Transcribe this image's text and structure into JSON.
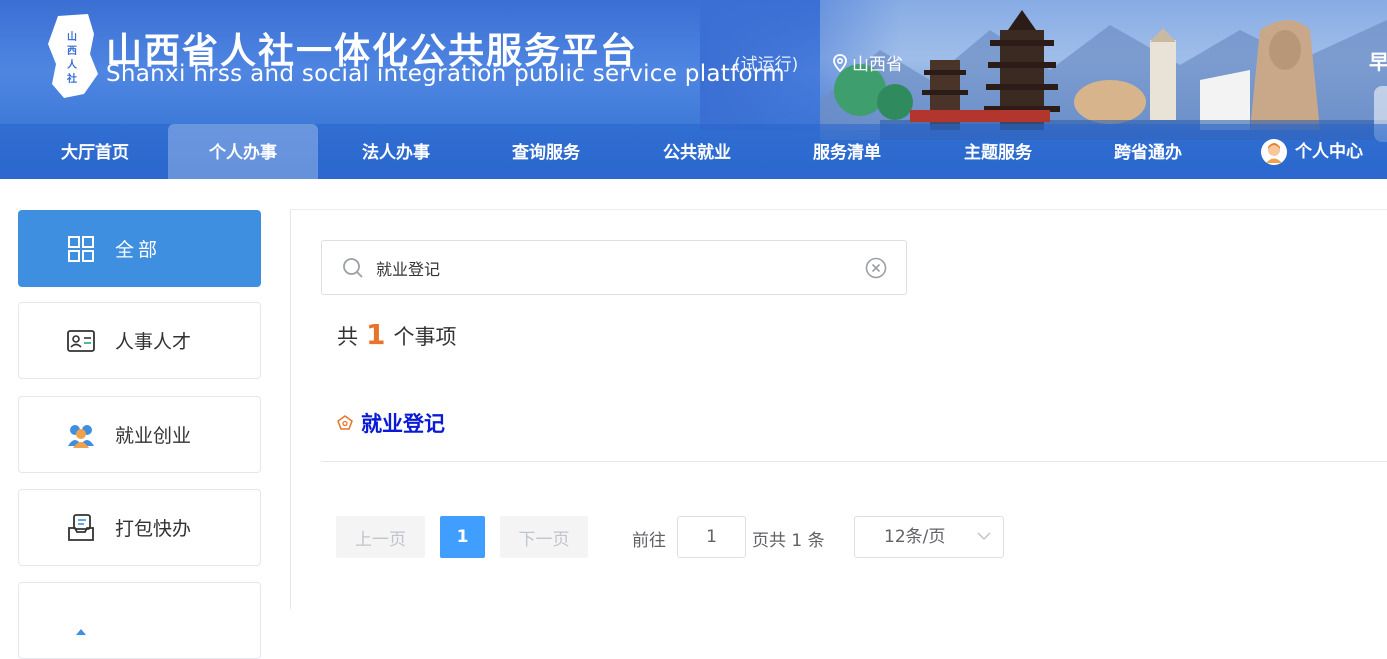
{
  "header": {
    "title_cn": "山西省人社一体化公共服务平台",
    "title_en": "Shanxi hrss and social integration public service platform",
    "trial": "(试运行)",
    "location": "山西省",
    "greeting": "早",
    "logo_text": "山西人社"
  },
  "nav": {
    "items": [
      {
        "label": "大厅首页"
      },
      {
        "label": "个人办事",
        "active": true
      },
      {
        "label": "法人办事"
      },
      {
        "label": "查询服务"
      },
      {
        "label": "公共就业"
      },
      {
        "label": "服务清单"
      },
      {
        "label": "主题服务"
      },
      {
        "label": "跨省通办"
      }
    ],
    "user_center": "个人中心"
  },
  "sidebar": {
    "items": [
      {
        "label": "全部",
        "icon": "grid-icon",
        "active": true
      },
      {
        "label": "人事人才",
        "icon": "id-card-icon"
      },
      {
        "label": "就业创业",
        "icon": "people-icon"
      },
      {
        "label": "打包快办",
        "icon": "package-icon"
      }
    ]
  },
  "search": {
    "value": "就业登记",
    "placeholder": ""
  },
  "results": {
    "prefix": "共",
    "count": "1",
    "suffix": "个事项",
    "items": [
      {
        "title": "就业登记"
      }
    ]
  },
  "pagination": {
    "prev": "上一页",
    "current_page": "1",
    "next": "下一页",
    "goto_prefix": "前往",
    "goto_value": "1",
    "goto_suffix": "页共 1 条",
    "page_size": "12条/页"
  },
  "colors": {
    "accent": "#409eff",
    "sidebar_active": "#3e8fe0",
    "count": "#e8742a",
    "result_link": "#0a1ad6"
  }
}
